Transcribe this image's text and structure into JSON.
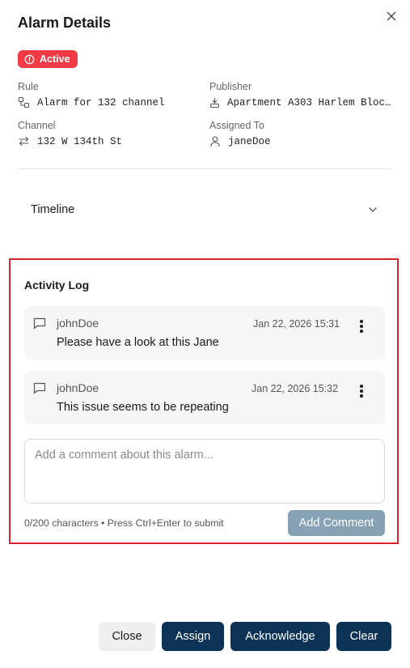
{
  "dialog": {
    "title": "Alarm Details"
  },
  "status": {
    "label": "Active",
    "color": "#f03a46"
  },
  "details": {
    "rule": {
      "label": "Rule",
      "value": "Alarm for 132 channel",
      "icon": "rule-icon"
    },
    "publisher": {
      "label": "Publisher",
      "value": "Apartment A303 Harlem Block…",
      "icon": "publisher-icon"
    },
    "channel": {
      "label": "Channel",
      "value": "132 W 134th St",
      "icon": "channel-arrows-icon"
    },
    "assigned_to": {
      "label": "Assigned To",
      "value": "janeDoe",
      "icon": "user-icon"
    }
  },
  "timeline": {
    "label": "Timeline",
    "expanded": false
  },
  "activity_log": {
    "title": "Activity Log",
    "comments": [
      {
        "author": "johnDoe",
        "time": "Jan 22, 2026 15:31",
        "text": "Please have a look at this Jane"
      },
      {
        "author": "johnDoe",
        "time": "Jan 22, 2026 15:32",
        "text": "This issue seems to be repeating"
      }
    ],
    "input": {
      "placeholder": "Add a comment about this alarm...",
      "value": ""
    },
    "hint": "0/200 characters • Press Ctrl+Enter to submit",
    "add_button": "Add Comment"
  },
  "footer": {
    "close": "Close",
    "assign": "Assign",
    "acknowledge": "Acknowledge",
    "clear": "Clear"
  },
  "colors": {
    "primary": "#0c3356",
    "highlight_border": "#d9232d",
    "disabled_button": "#87a1b5"
  }
}
